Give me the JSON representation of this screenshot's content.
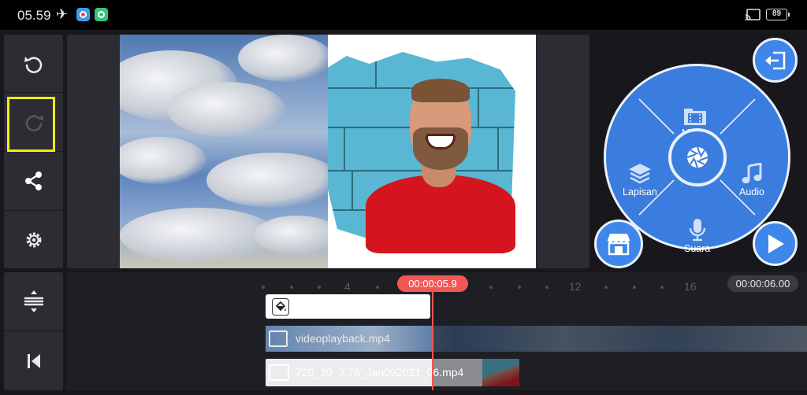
{
  "status_bar": {
    "time": "05.59",
    "battery": "89",
    "icons": [
      "airplane-mode-icon",
      "app-notification-icon",
      "app-notification-icon",
      "cast-icon",
      "battery-icon"
    ]
  },
  "toolbar": {
    "buttons": [
      "undo-icon",
      "redo-icon",
      "share-icon",
      "settings-icon"
    ],
    "bottom_buttons": [
      "split-tracks-icon",
      "jump-to-start-icon"
    ]
  },
  "media_wheel": {
    "center": "camera-aperture-icon",
    "items": [
      {
        "label": "Media",
        "icon": "media-film-icon"
      },
      {
        "label": "Audio",
        "icon": "music-note-icon"
      },
      {
        "label": "Suara",
        "icon": "microphone-icon"
      },
      {
        "label": "Lapisan",
        "icon": "layers-icon"
      }
    ],
    "exit_icon": "exit-icon",
    "store_icon": "store-icon",
    "play_icon": "play-icon"
  },
  "timeline": {
    "current_time": "00:00:05.9",
    "total_time": "00:00:06.00",
    "ruler_labels": [
      "4",
      "12",
      "16"
    ],
    "tracks": {
      "background_fill_icon": "paint-bucket-icon",
      "video_clip_name": "videoplayback.mp4",
      "image_clip_name": "720_30_3.78_Jan092021_06.mp4"
    }
  },
  "colors": {
    "accent": "#3a7ddf",
    "playhead": "#f25754",
    "highlight": "#f3ea11"
  }
}
